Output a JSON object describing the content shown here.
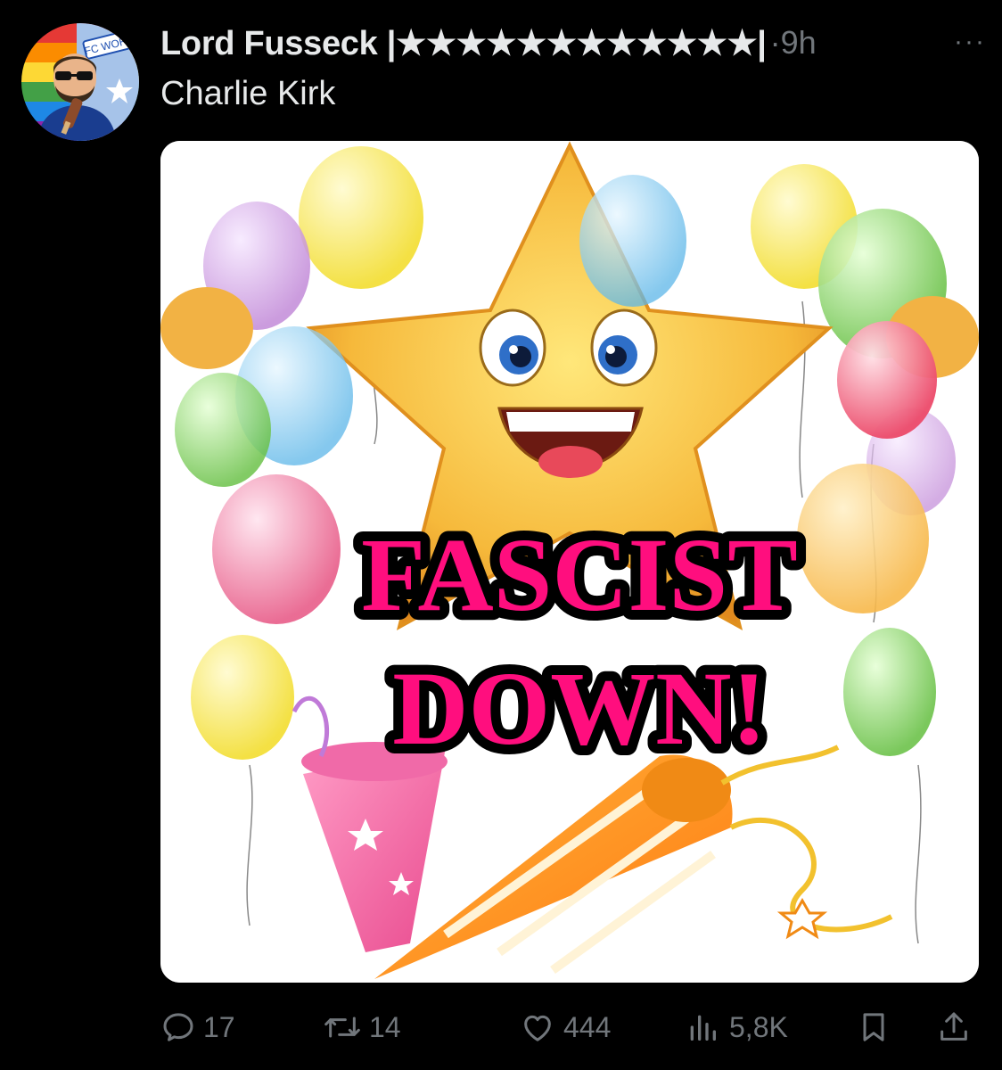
{
  "post": {
    "display_name": "Lord Fusseck |★★★★★★★★★★★★|",
    "separator": "·",
    "time": "9h",
    "more_label": "···",
    "text": "Charlie Kirk",
    "avatar_badge_text": "FC WOHL"
  },
  "media": {
    "caption_line1": "FASCIST",
    "caption_line2": "DOWN!",
    "caption_color": "#ff0e7e"
  },
  "actions": {
    "replies": "17",
    "reposts": "14",
    "likes": "444",
    "views": "5,8K"
  },
  "icons": {
    "reply": "reply-icon",
    "repost": "repost-icon",
    "like": "heart-icon",
    "views": "views-icon",
    "bookmark": "bookmark-icon",
    "share": "share-icon"
  }
}
